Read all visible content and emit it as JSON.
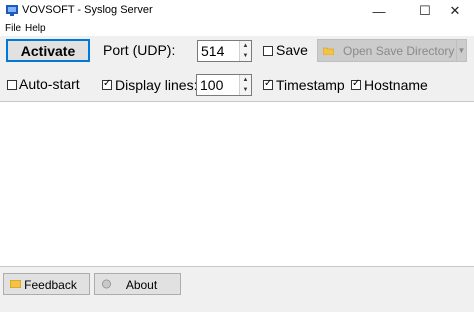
{
  "window": {
    "title": "VOVSOFT - Syslog Server",
    "minimize_glyph": "—",
    "maximize_glyph": "☐",
    "close_glyph": "✕"
  },
  "menu": {
    "items": [
      "File",
      "Help"
    ]
  },
  "controls": {
    "activate_label": "Activate",
    "port_label": "Port (UDP):",
    "port_value": "514",
    "save_label": "Save",
    "save_checked": false,
    "open_dir_label": "Open Save Directory",
    "autostart_label": "Auto-start",
    "autostart_checked": false,
    "display_lines_label": "Display lines:",
    "display_lines_checked": true,
    "display_lines_value": "100",
    "timestamp_label": "Timestamp",
    "timestamp_checked": true,
    "hostname_label": "Hostname",
    "hostname_checked": true
  },
  "footer": {
    "feedback_label": "Feedback",
    "about_label": "About"
  },
  "colors": {
    "accent": "#0078d7",
    "folder_yellow": "#f5c342",
    "disabled_text": "#8a8a8a"
  }
}
